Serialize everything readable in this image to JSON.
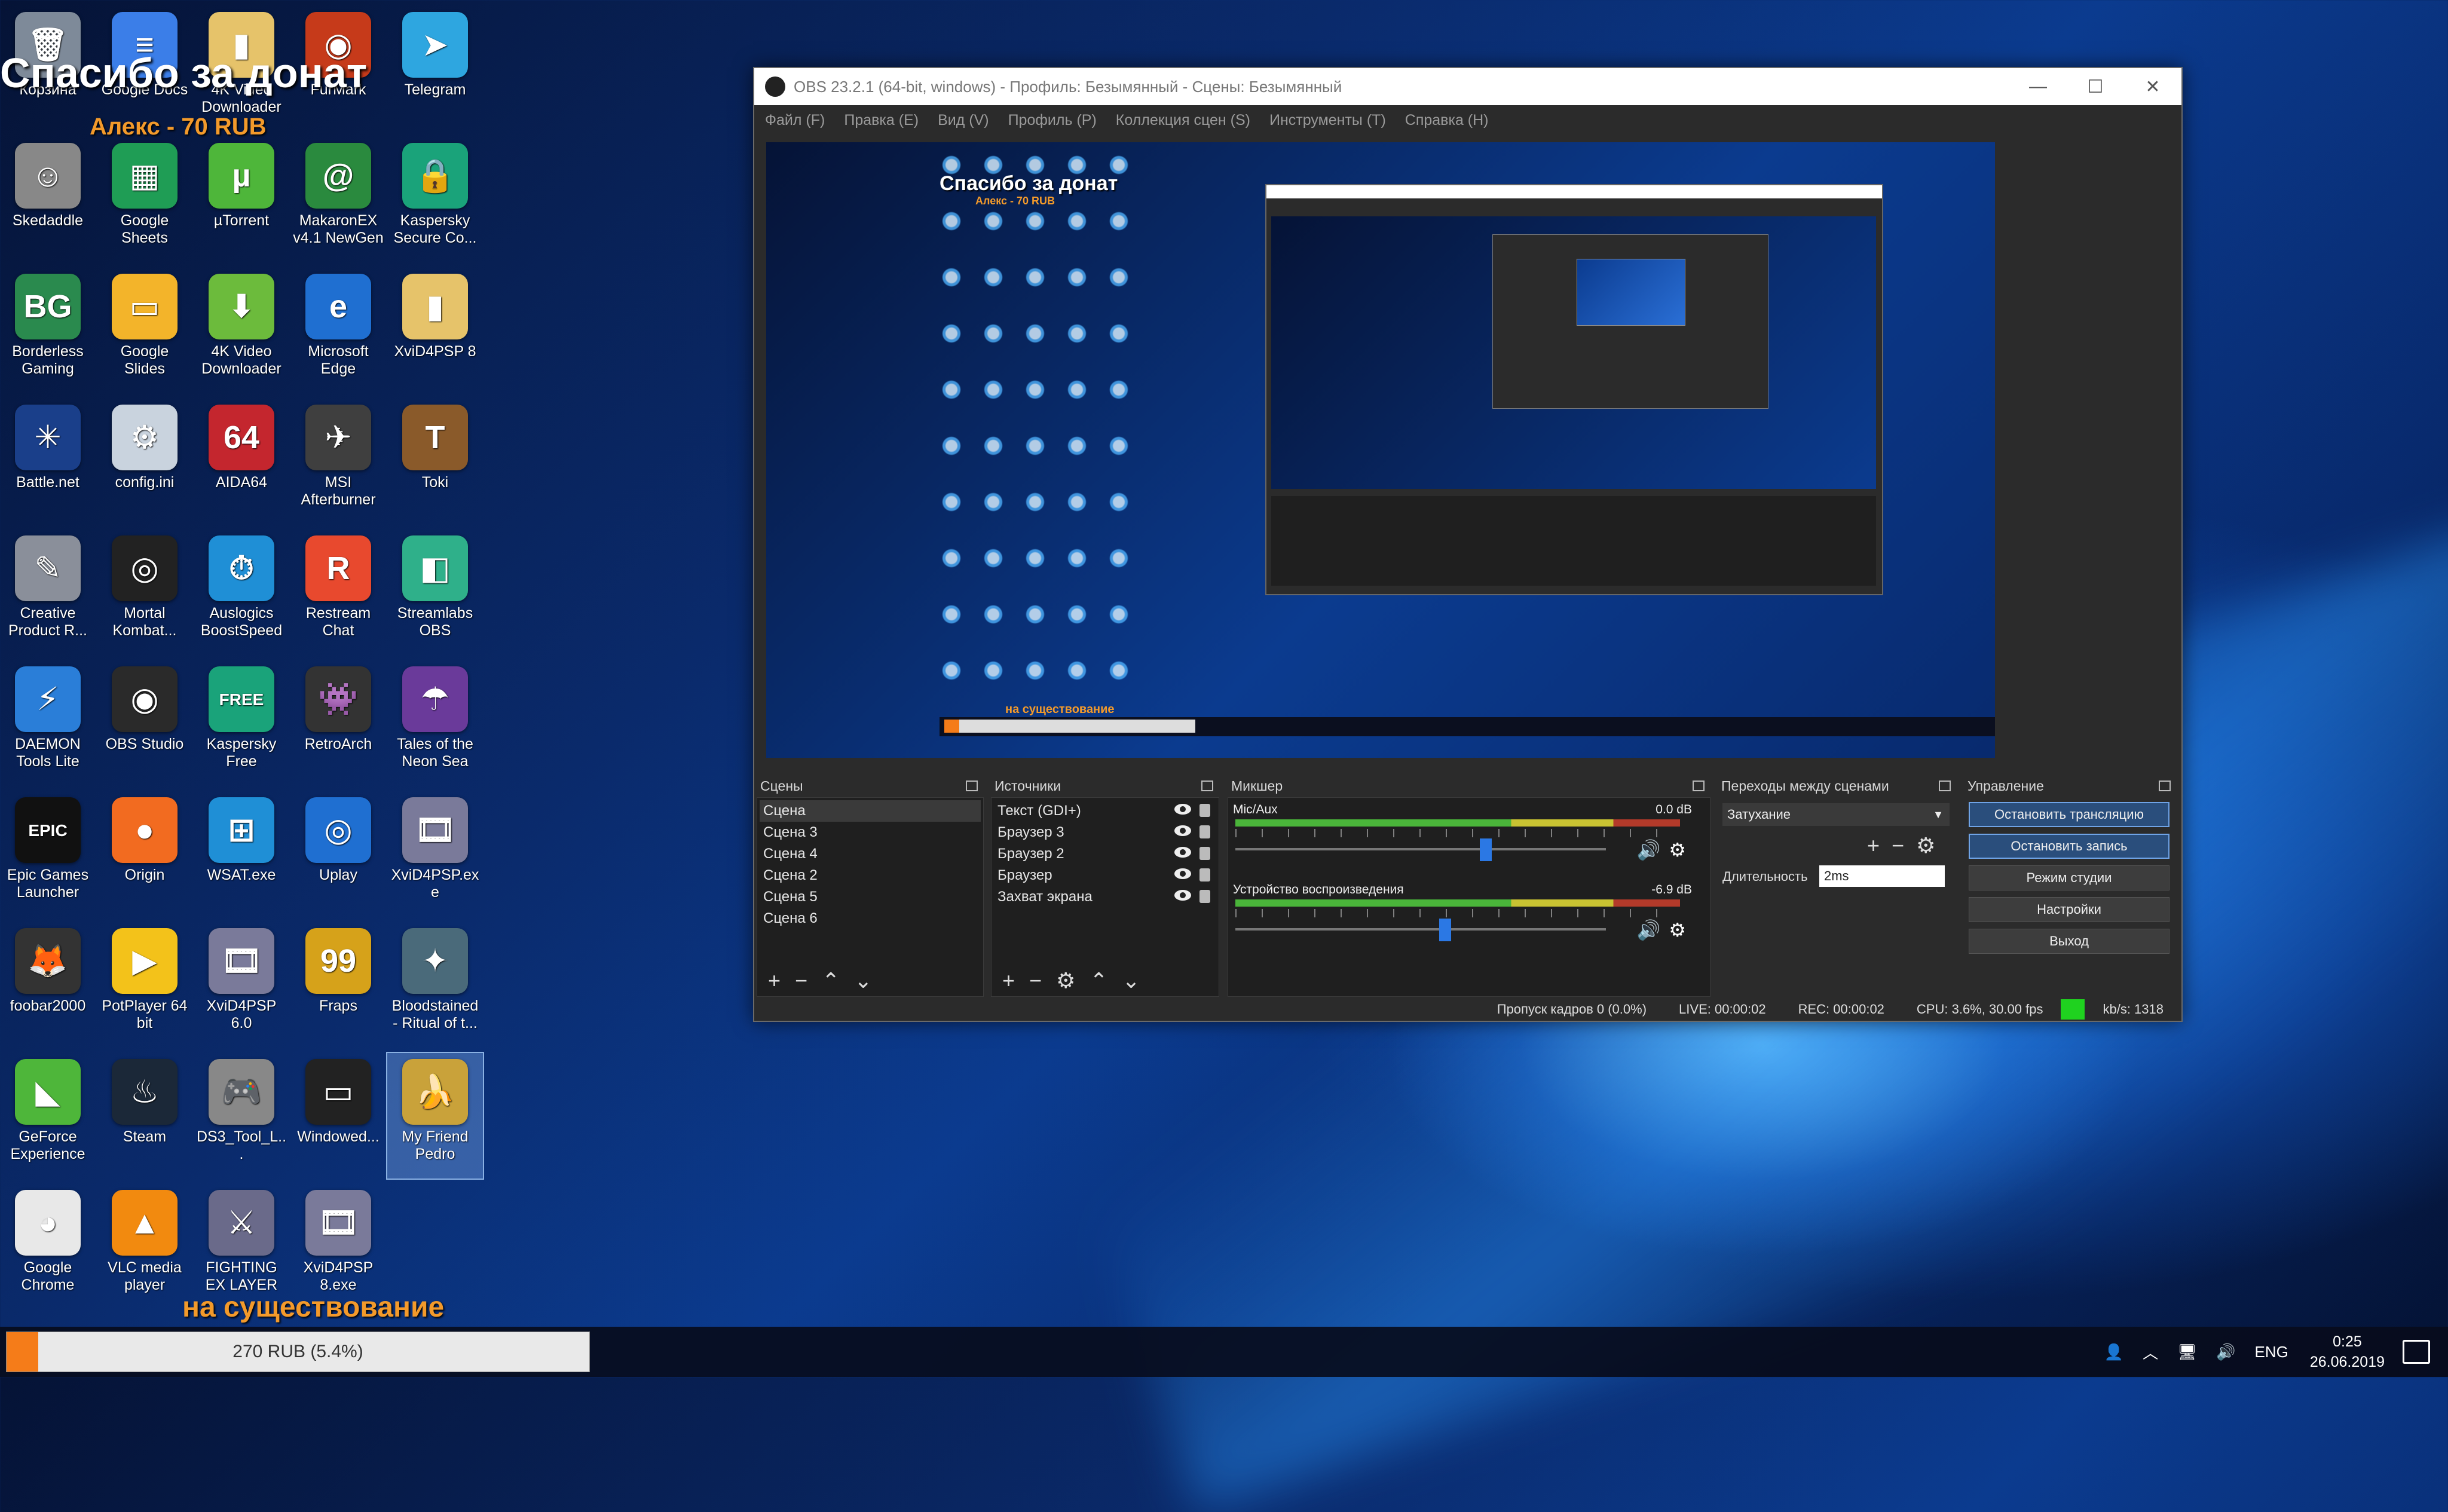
{
  "desktop": {
    "donate_title": "Спасибо за донат",
    "donate_sub": "Алекс - 70 RUB",
    "goal_text": "на существование",
    "goal_bar_label": "270 RUB (5.4%)",
    "goal_progress": 0.054,
    "icons": [
      {
        "label": "Корзина",
        "icon": "recycle-bin-icon",
        "color": "#7e8a99",
        "glyph": "🗑"
      },
      {
        "label": "Google Docs",
        "icon": "google-docs-icon",
        "color": "#3b7ee8",
        "glyph": "≡"
      },
      {
        "label": "4K Video Downloader",
        "icon": "folder-icon",
        "color": "#e6c36a",
        "glyph": "▮"
      },
      {
        "label": "FurMark",
        "icon": "furmark-icon",
        "color": "#c63a1a",
        "glyph": "◉"
      },
      {
        "label": "Telegram",
        "icon": "telegram-icon",
        "color": "#2ea6e0",
        "glyph": "➤"
      },
      {
        "label": "Skedaddle",
        "icon": "astronaut-icon",
        "color": "#888888",
        "glyph": "☺"
      },
      {
        "label": "Google Sheets",
        "icon": "google-sheets-icon",
        "color": "#1f9d55",
        "glyph": "▦"
      },
      {
        "label": "µTorrent",
        "icon": "utorrent-icon",
        "color": "#4eb63a",
        "glyph": "µ"
      },
      {
        "label": "MakaronEX v4.1 NewGen",
        "icon": "spiral-icon",
        "color": "#2a8a3e",
        "glyph": "@"
      },
      {
        "label": "Kaspersky Secure Co...",
        "icon": "kaspersky-secure-icon",
        "color": "#1aa37a",
        "glyph": "🔒"
      },
      {
        "label": "Borderless Gaming",
        "icon": "borderless-gaming-icon",
        "color": "#2a8a4e",
        "glyph": "BG"
      },
      {
        "label": "Google Slides",
        "icon": "google-slides-icon",
        "color": "#f3b42a",
        "glyph": "▭"
      },
      {
        "label": "4K Video Downloader",
        "icon": "4k-downloader-icon",
        "color": "#6cbb3c",
        "glyph": "⬇"
      },
      {
        "label": "Microsoft Edge",
        "icon": "edge-icon",
        "color": "#1f6fd1",
        "glyph": "e"
      },
      {
        "label": "XviD4PSP 8",
        "icon": "folder-icon",
        "color": "#e6c36a",
        "glyph": "▮"
      },
      {
        "label": "Battle.net",
        "icon": "battlenet-icon",
        "color": "#1a3f8a",
        "glyph": "✳"
      },
      {
        "label": "config.ini",
        "icon": "config-file-icon",
        "color": "#c9d3de",
        "glyph": "⚙"
      },
      {
        "label": "AIDA64",
        "icon": "aida64-icon",
        "color": "#c4262e",
        "glyph": "64"
      },
      {
        "label": "MSI Afterburner",
        "icon": "msi-afterburner-icon",
        "color": "#3f3f3f",
        "glyph": "✈"
      },
      {
        "label": "Toki",
        "icon": "toki-game-icon",
        "color": "#8a5a2a",
        "glyph": "T"
      },
      {
        "label": "Creative Product R...",
        "icon": "creative-icon",
        "color": "#8a8f9a",
        "glyph": "✎"
      },
      {
        "label": "Mortal Kombat...",
        "icon": "mortal-kombat-icon",
        "color": "#222222",
        "glyph": "◎"
      },
      {
        "label": "Auslogics BoostSpeed",
        "icon": "auslogics-icon",
        "color": "#1f8fd6",
        "glyph": "⏱"
      },
      {
        "label": "Restream Chat",
        "icon": "restream-icon",
        "color": "#e8492e",
        "glyph": "R"
      },
      {
        "label": "Streamlabs OBS",
        "icon": "streamlabs-icon",
        "color": "#2fb08a",
        "glyph": "◧"
      },
      {
        "label": "DAEMON Tools Lite",
        "icon": "daemon-tools-icon",
        "color": "#2a7ed8",
        "glyph": "⚡"
      },
      {
        "label": "OBS Studio",
        "icon": "obs-icon",
        "color": "#2a2a2a",
        "glyph": "◉"
      },
      {
        "label": "Kaspersky Free",
        "icon": "kaspersky-free-icon",
        "color": "#1aa37a",
        "glyph": "FREE"
      },
      {
        "label": "RetroArch",
        "icon": "retroarch-icon",
        "color": "#333333",
        "glyph": "👾"
      },
      {
        "label": "Tales of the Neon Sea",
        "icon": "neon-sea-icon",
        "color": "#6a3a9a",
        "glyph": "☂"
      },
      {
        "label": "Epic Games Launcher",
        "icon": "epic-games-icon",
        "color": "#111111",
        "glyph": "EPIC"
      },
      {
        "label": "Origin",
        "icon": "origin-icon",
        "color": "#f26b20",
        "glyph": "●"
      },
      {
        "label": "WSAT.exe",
        "icon": "windows-icon",
        "color": "#1f8fd6",
        "glyph": "⊞"
      },
      {
        "label": "Uplay",
        "icon": "uplay-icon",
        "color": "#1f6fd1",
        "glyph": "◎"
      },
      {
        "label": "XviD4PSP.exe",
        "icon": "xvid-icon",
        "color": "#7a7a9a",
        "glyph": "🎞"
      },
      {
        "label": "foobar2000",
        "icon": "foobar-icon",
        "color": "#333333",
        "glyph": "🦊"
      },
      {
        "label": "PotPlayer 64 bit",
        "icon": "potplayer-icon",
        "color": "#f3c21a",
        "glyph": "▶"
      },
      {
        "label": "XviD4PSP 6.0",
        "icon": "xvid-icon",
        "color": "#7a7a9a",
        "glyph": "🎞"
      },
      {
        "label": "Fraps",
        "icon": "fraps-icon",
        "color": "#d6a21a",
        "glyph": "99"
      },
      {
        "label": "Bloodstained - Ritual of t...",
        "icon": "bloodstained-icon",
        "color": "#4a6a7a",
        "glyph": "✦"
      },
      {
        "label": "GeForce Experience",
        "icon": "geforce-icon",
        "color": "#4eb63a",
        "glyph": "◣"
      },
      {
        "label": "Steam",
        "icon": "steam-icon",
        "color": "#1b2838",
        "glyph": "♨"
      },
      {
        "label": "DS3_Tool_L...",
        "icon": "gamepad-icon",
        "color": "#888888",
        "glyph": "🎮"
      },
      {
        "label": "Windowed...",
        "icon": "windowed-icon",
        "color": "#222222",
        "glyph": "▭"
      },
      {
        "label": "My Friend Pedro",
        "icon": "banana-icon",
        "color": "#c9a23a",
        "glyph": "🍌"
      },
      {
        "label": "Google Chrome",
        "icon": "chrome-icon",
        "color": "#e8e8e8",
        "glyph": "◕"
      },
      {
        "label": "VLC media player",
        "icon": "vlc-icon",
        "color": "#f28a0f",
        "glyph": "▲"
      },
      {
        "label": "FIGHTING EX LAYER",
        "icon": "fighting-ex-icon",
        "color": "#6a6a8a",
        "glyph": "⚔"
      },
      {
        "label": "XviD4PSP 8.exe",
        "icon": "xvid-icon",
        "color": "#7a7a9a",
        "glyph": "🎞"
      }
    ]
  },
  "obs": {
    "title": "OBS 23.2.1 (64-bit, windows) - Профиль: Безымянный - Сцены: Безымянный",
    "menu": [
      "Файл (F)",
      "Правка (E)",
      "Вид (V)",
      "Профиль (P)",
      "Коллекция сцен (S)",
      "Инструменты (T)",
      "Справка (H)"
    ],
    "docks": {
      "scenes": {
        "title": "Сцены",
        "items": [
          "Сцена",
          "Сцена 3",
          "Сцена 4",
          "Сцена 2",
          "Сцена 5",
          "Сцена 6"
        ],
        "selected": 0
      },
      "sources": {
        "title": "Источники",
        "items": [
          "Текст (GDI+)",
          "Браузер 3",
          "Браузер 2",
          "Браузер",
          "Захват экрана"
        ]
      },
      "mixer": {
        "title": "Микшер",
        "channels": [
          {
            "name": "Mic/Aux",
            "db": "0.0 dB",
            "level": 0.66
          },
          {
            "name": "Устройство воспроизведения",
            "db": "-6.9 dB",
            "level": 0.55
          }
        ]
      },
      "transitions": {
        "title": "Переходы между сценами",
        "selected": "Затухание",
        "duration_label": "Длительность",
        "duration_value": "2ms"
      },
      "controls": {
        "title": "Управление",
        "buttons": [
          "Остановить трансляцию",
          "Остановить запись",
          "Режим студии",
          "Настройки",
          "Выход"
        ]
      }
    },
    "status": {
      "dropped": "Пропуск кадров 0 (0.0%)",
      "live": "LIVE: 00:00:02",
      "rec": "REC: 00:00:02",
      "cpu": "CPU: 3.6%, 30.00 fps",
      "kbs": "kb/s: 1318",
      "indicator_color": "#1fd21f"
    }
  },
  "taskbar": {
    "lang": "ENG",
    "time": "0:25",
    "date": "26.06.2019"
  }
}
